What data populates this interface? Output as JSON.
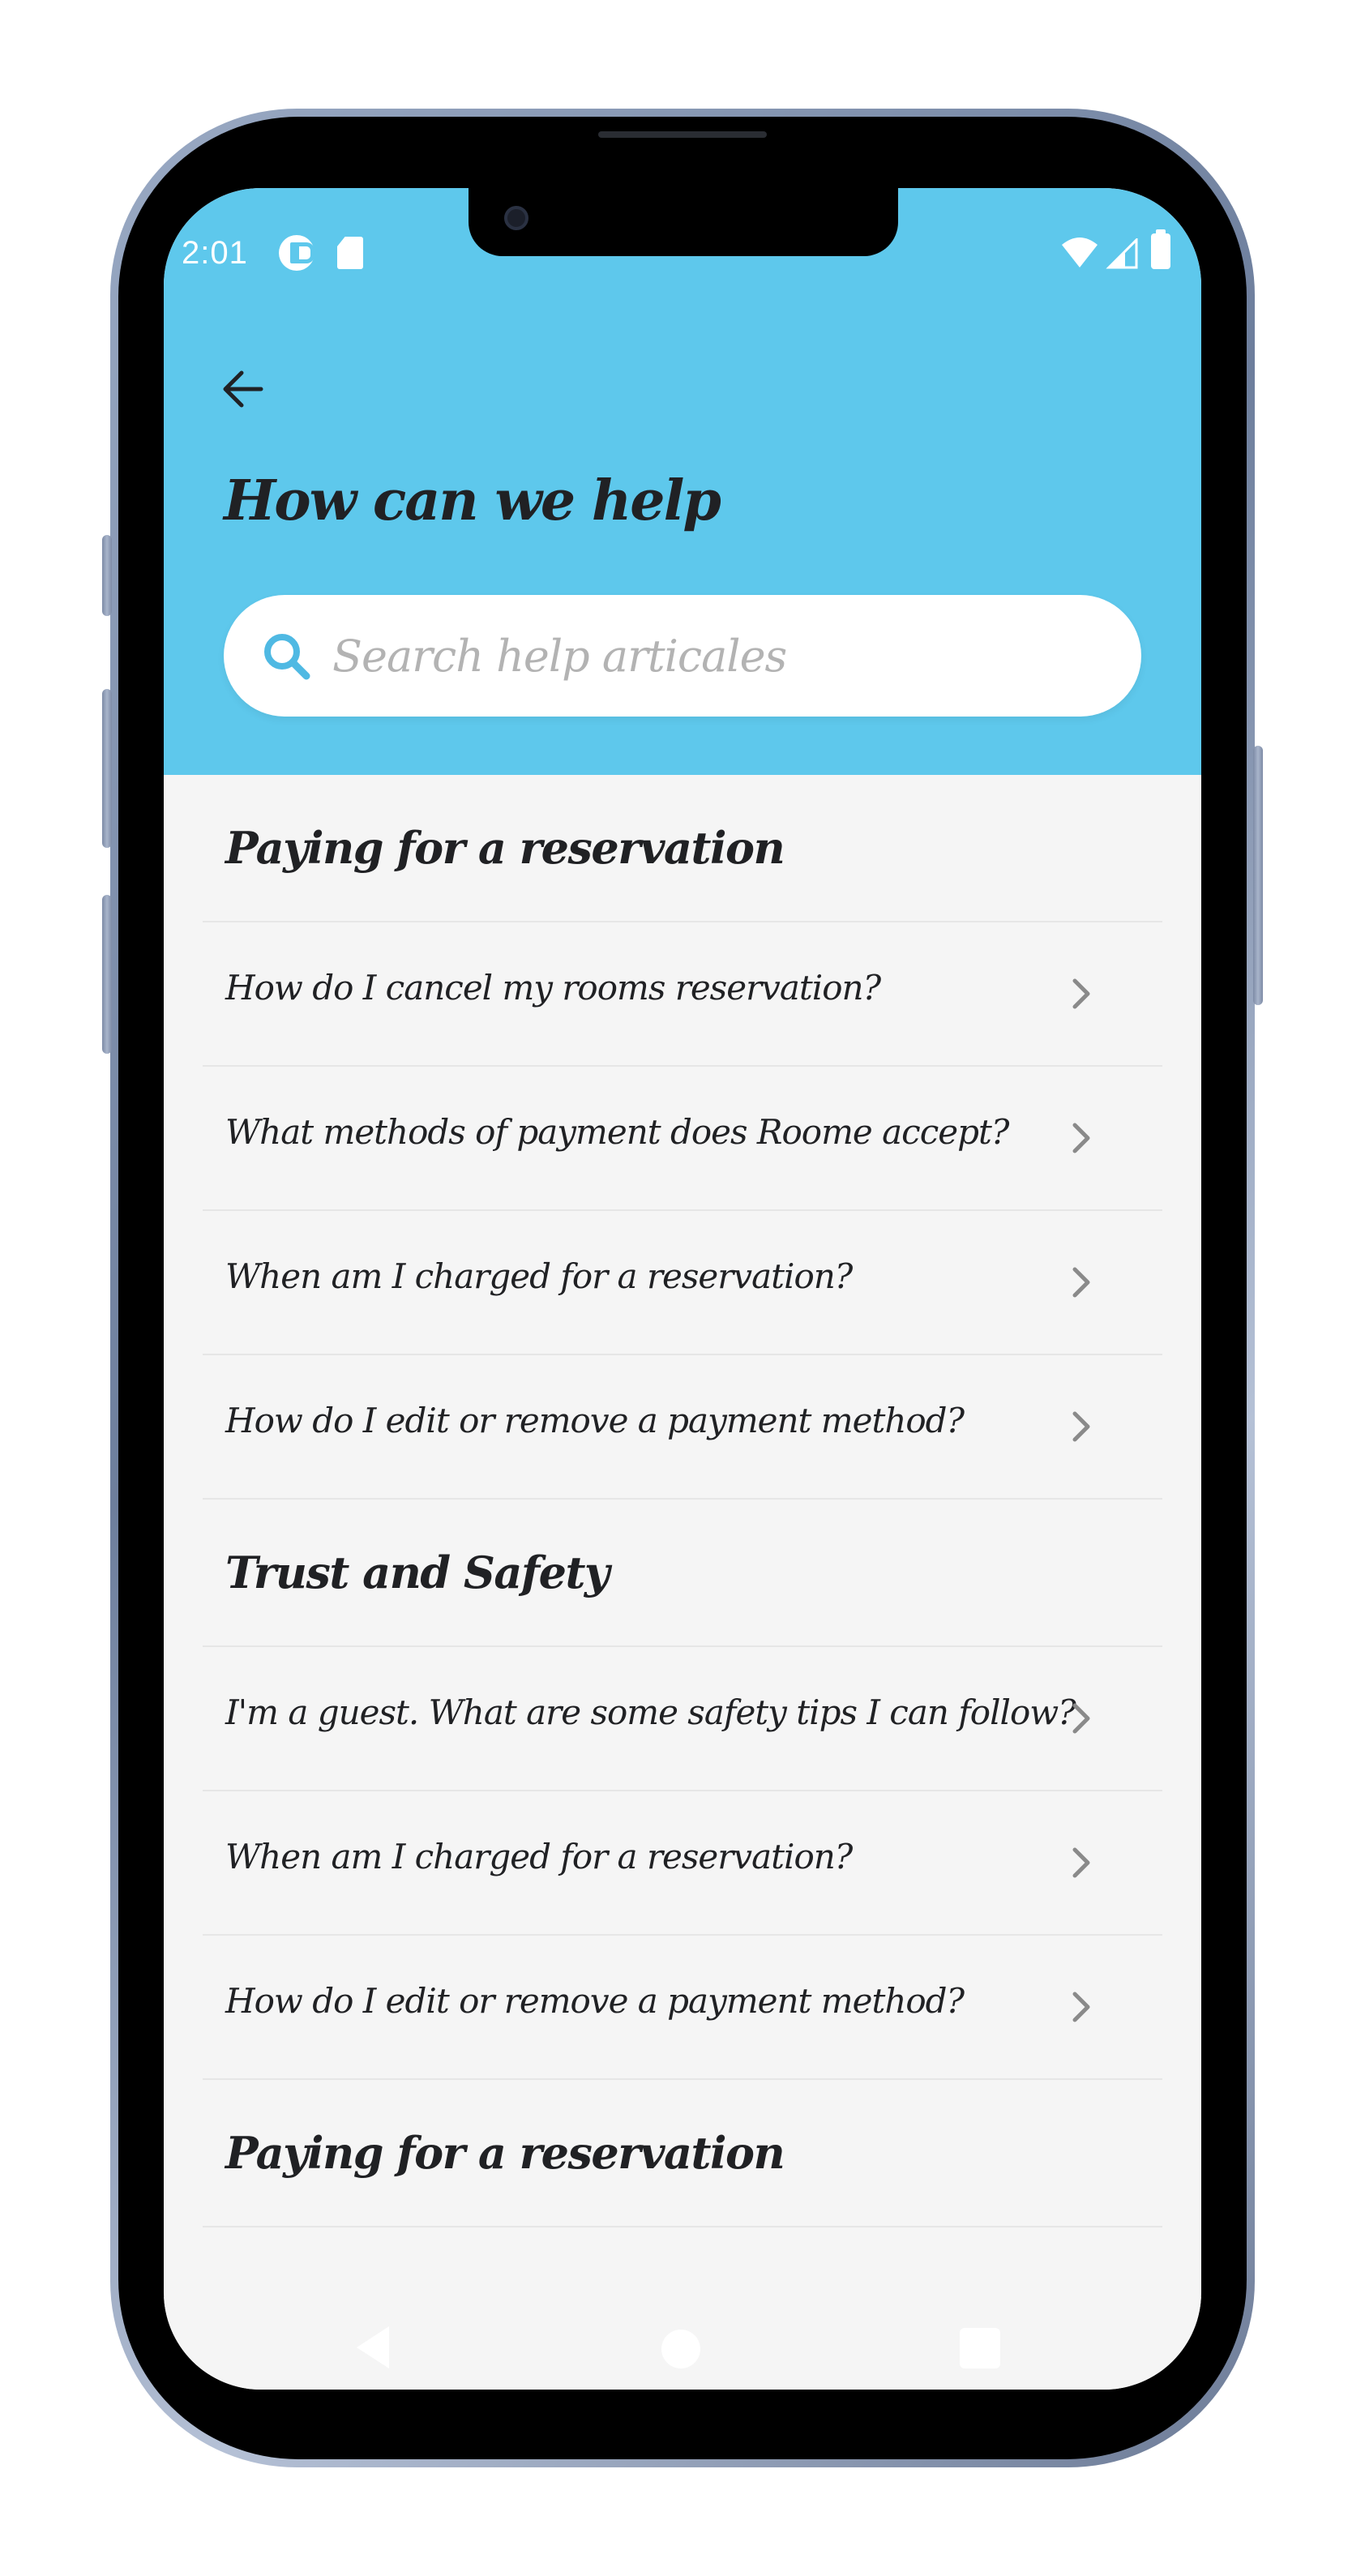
{
  "status_bar": {
    "time": "2:01",
    "icons": [
      "app-notification-icon",
      "sd-card-icon",
      "wifi-icon",
      "cell-signal-icon",
      "battery-icon"
    ]
  },
  "header": {
    "back_icon": "arrow-left-icon",
    "title": "How can we help",
    "background_color": "#5ec8ec"
  },
  "search": {
    "placeholder": "Search help articales",
    "value": "",
    "icon": "search-icon",
    "icon_color": "#4fb9e3"
  },
  "sections": [
    {
      "title": "Paying for a reservation",
      "items": [
        {
          "label": "How do I cancel my rooms reservation?"
        },
        {
          "label": "What methods of payment does Roome accept?"
        },
        {
          "label": "When am I charged for a reservation?"
        },
        {
          "label": "How do I edit or remove a payment method?"
        }
      ]
    },
    {
      "title": "Trust and Safety",
      "items": [
        {
          "label": "I'm a guest. What are some safety tips I can follow?"
        },
        {
          "label": "When am I charged for a reservation?"
        },
        {
          "label": "How do I edit or remove a payment method?"
        }
      ]
    },
    {
      "title": "Paying for a reservation",
      "items": []
    }
  ],
  "row_chevron_icon": "chevron-right-icon",
  "nav_bar": {
    "buttons": [
      "nav-back-icon",
      "nav-home-icon",
      "nav-recents-icon"
    ]
  }
}
